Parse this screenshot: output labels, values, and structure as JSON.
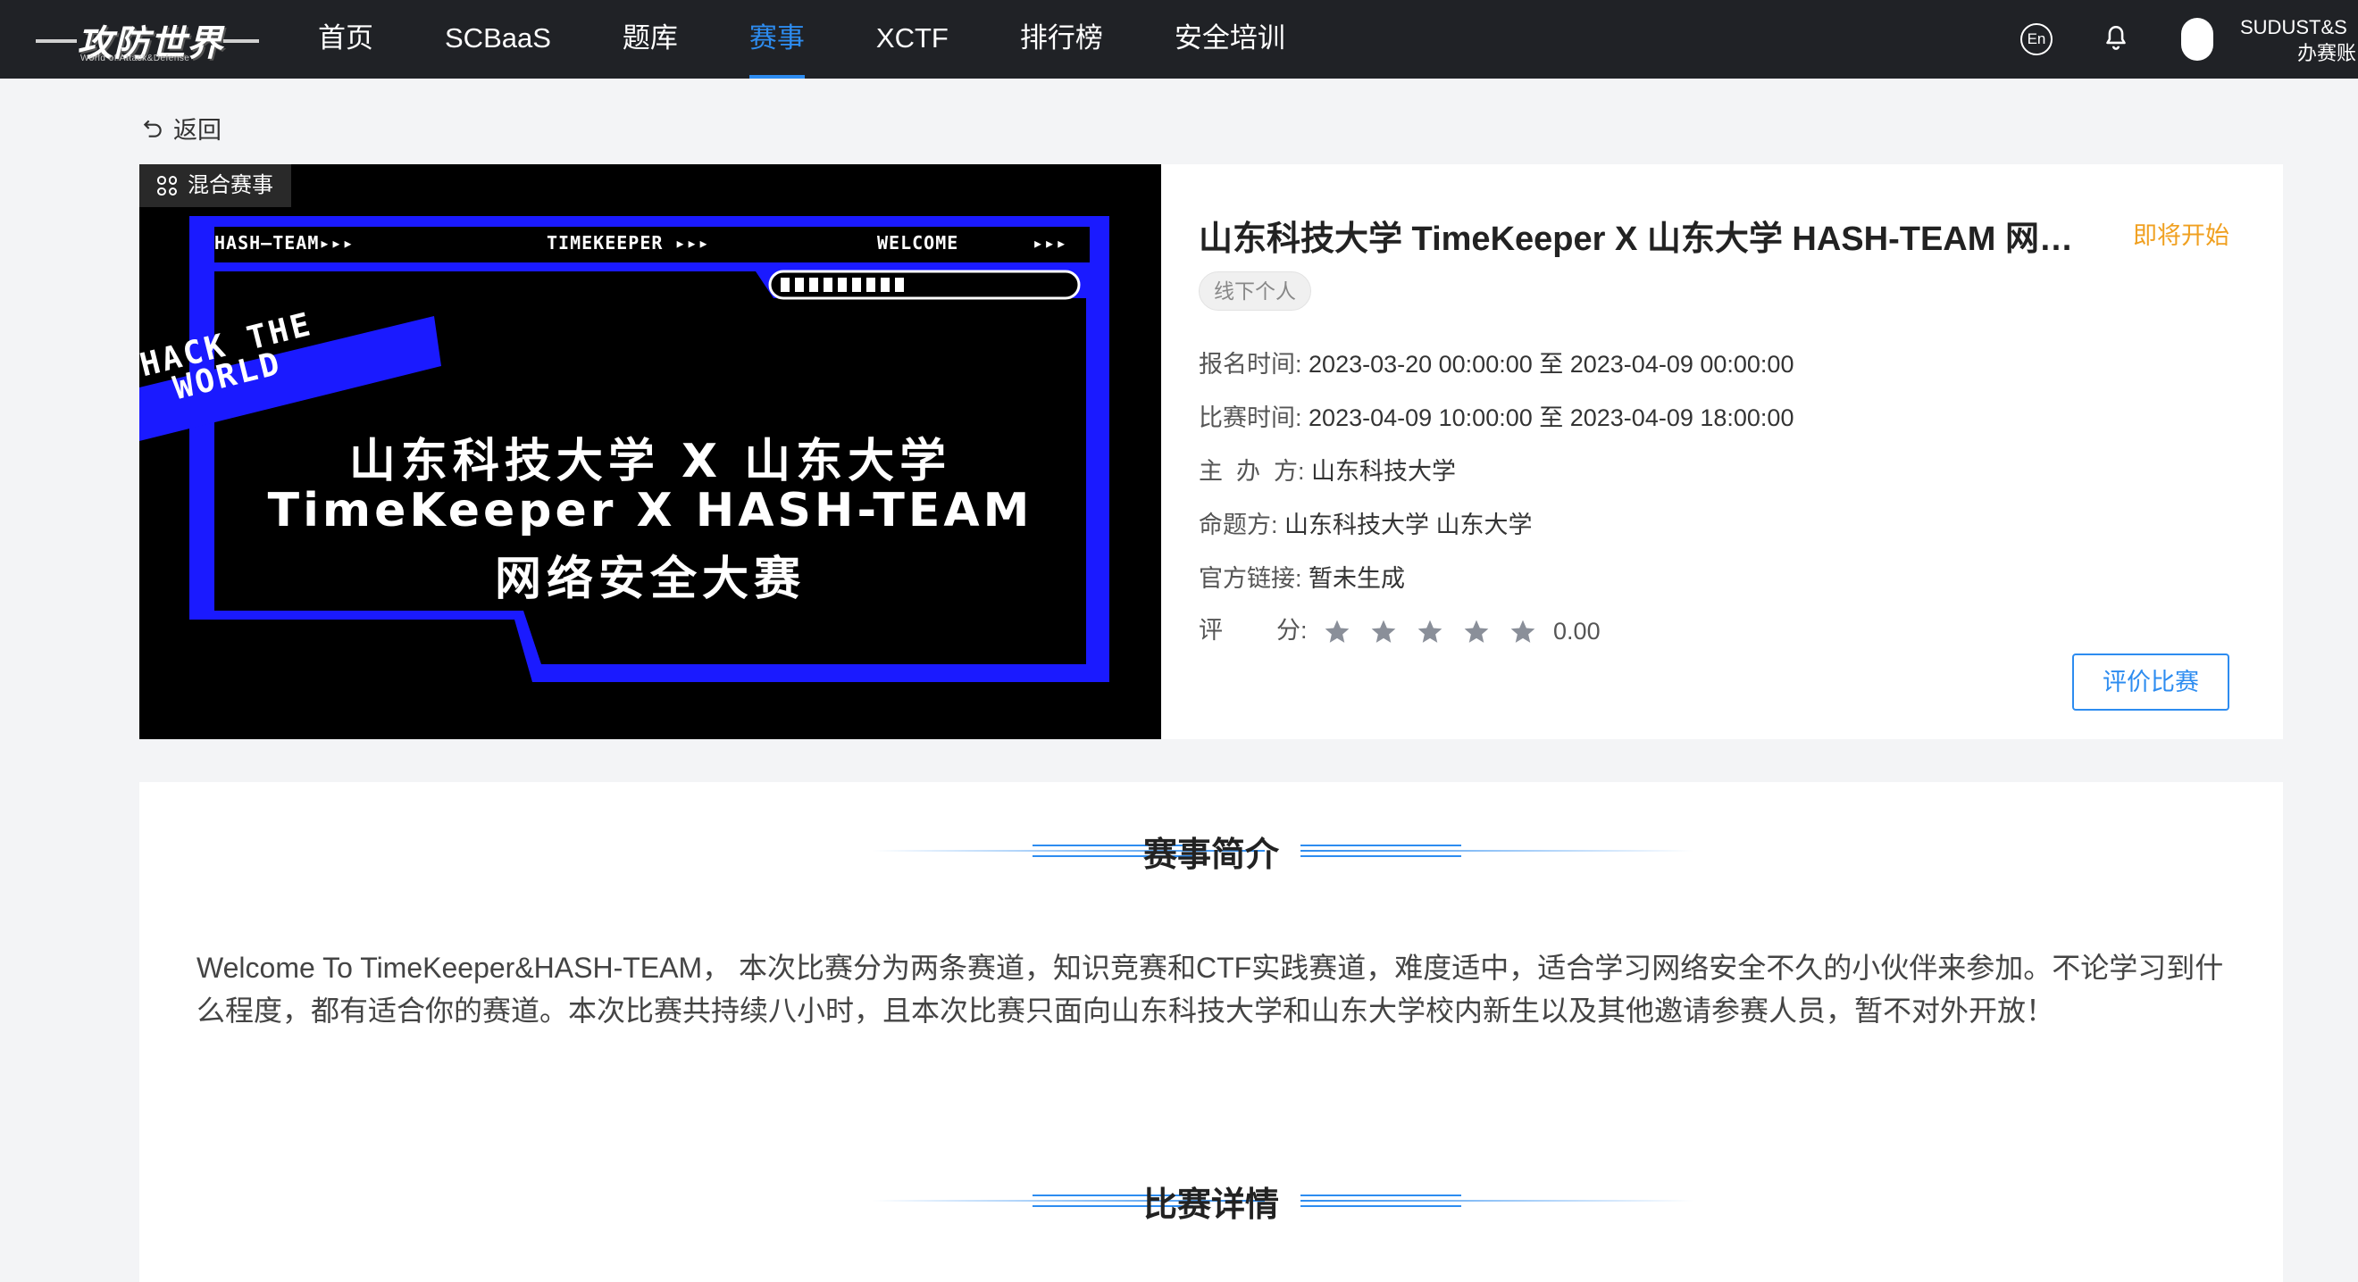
{
  "header": {
    "logo_text": "攻防世界",
    "logo_sub": "World of Attack&Defense",
    "nav": [
      {
        "label": "首页",
        "active": false
      },
      {
        "label": "SCBaaS",
        "active": false
      },
      {
        "label": "题库",
        "active": false
      },
      {
        "label": "赛事",
        "active": true
      },
      {
        "label": "XCTF",
        "active": false
      },
      {
        "label": "排行榜",
        "active": false
      },
      {
        "label": "安全培训",
        "active": false
      }
    ],
    "lang_label": "En",
    "user_name": "SUDUST&S",
    "user_role": "办赛账"
  },
  "back_label": "返回",
  "event": {
    "category_tag": "混合赛事",
    "banner": {
      "hdr_left": "HASH—TEAM▸▸▸",
      "hdr_mid": "TIMEKEEPER ▸▸▸",
      "hdr_right": "WELCOME",
      "hdr_arrows": "▸▸▸",
      "hack_line1": "HACK THE",
      "hack_line2": "WORLD",
      "line1": "山东科技大学 X 山东大学",
      "line2": "TimeKeeper X HASH-TEAM",
      "line3": "网络安全大赛"
    },
    "title": "山东科技大学 TimeKeeper X 山东大学 HASH-TEAM 网络安全大赛",
    "status": "即将开始",
    "mode_tag": "线下个人",
    "signup_label": "报名时间:",
    "signup_value": "2023-03-20 00:00:00 至 2023-04-09 00:00:00",
    "match_label": "比赛时间:",
    "match_value": "2023-04-09 10:00:00 至 2023-04-09 18:00:00",
    "organizer_label": "主  办  方:",
    "organizer_value": "山东科技大学",
    "setter_label": "命题方:",
    "setter_value": "山东科技大学 山东大学",
    "link_label": "官方链接:",
    "link_value": "暂未生成",
    "rating_label": "评        分:",
    "rating_value": "0.00",
    "rating_stars": 0,
    "rate_button": "评价比赛"
  },
  "intro": {
    "title": "赛事简介",
    "text": "Welcome To TimeKeeper&HASH-TEAM， 本次比赛分为两条赛道，知识竞赛和CTF实践赛道，难度适中，适合学习网络安全不久的小伙伴来参加。不论学习到什么程度，都有适合你的赛道。本次比赛共持续八小时，且本次比赛只面向山东科技大学和山东大学校内新生以及其他邀请参赛人员，暂不对外开放！"
  },
  "details": {
    "title": "比赛详情"
  },
  "colors": {
    "topbar": "#202226",
    "accent": "#2d8cf0",
    "status": "#f0a020",
    "banner_blue": "#1a1aff"
  }
}
